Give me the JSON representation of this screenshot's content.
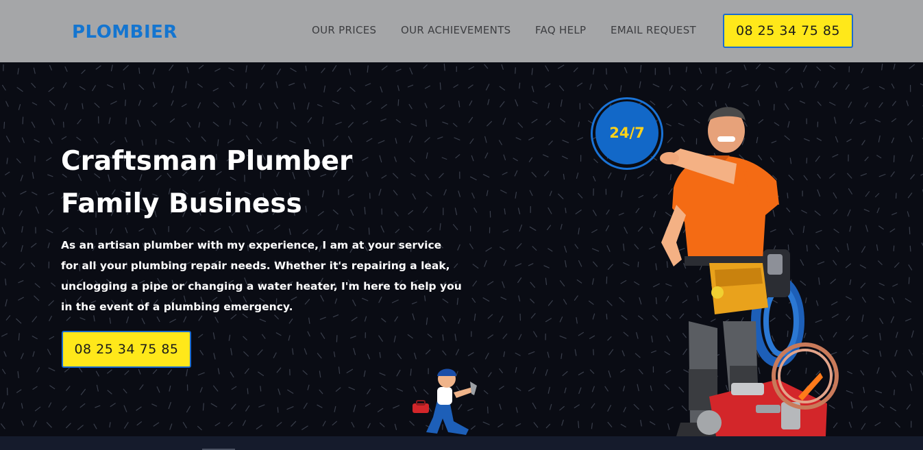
{
  "header": {
    "logo": "PLOMBIER",
    "nav": [
      {
        "label": "OUR PRICES"
      },
      {
        "label": "OUR ACHIEVEMENTS"
      },
      {
        "label": "FAQ HELP"
      },
      {
        "label": "EMAIL REQUEST"
      }
    ],
    "phone_button": "08 25 34 75 85"
  },
  "hero": {
    "title_line1": "Craftsman Plumber",
    "title_line2": "Family Business",
    "text": "As an artisan plumber with my experience, I am at your service for all your plumbing repair needs. Whether it's repairing a leak, unclogging a pipe or changing a water heater, I'm here to help you in the event of a plumbing emergency.",
    "phone_button": "08 25 34 75 85",
    "badge": "24/7"
  },
  "colors": {
    "header_bg": "#a5a6a8",
    "brand_blue": "#1475d0",
    "button_yellow": "#ffe81a",
    "hero_bg": "#0a0c14",
    "badge_text": "#ffd21a"
  },
  "icons": {
    "plumber_photo": "plumber-man-pointing-image",
    "mascot": "cartoon-plumber-mascot-image"
  }
}
